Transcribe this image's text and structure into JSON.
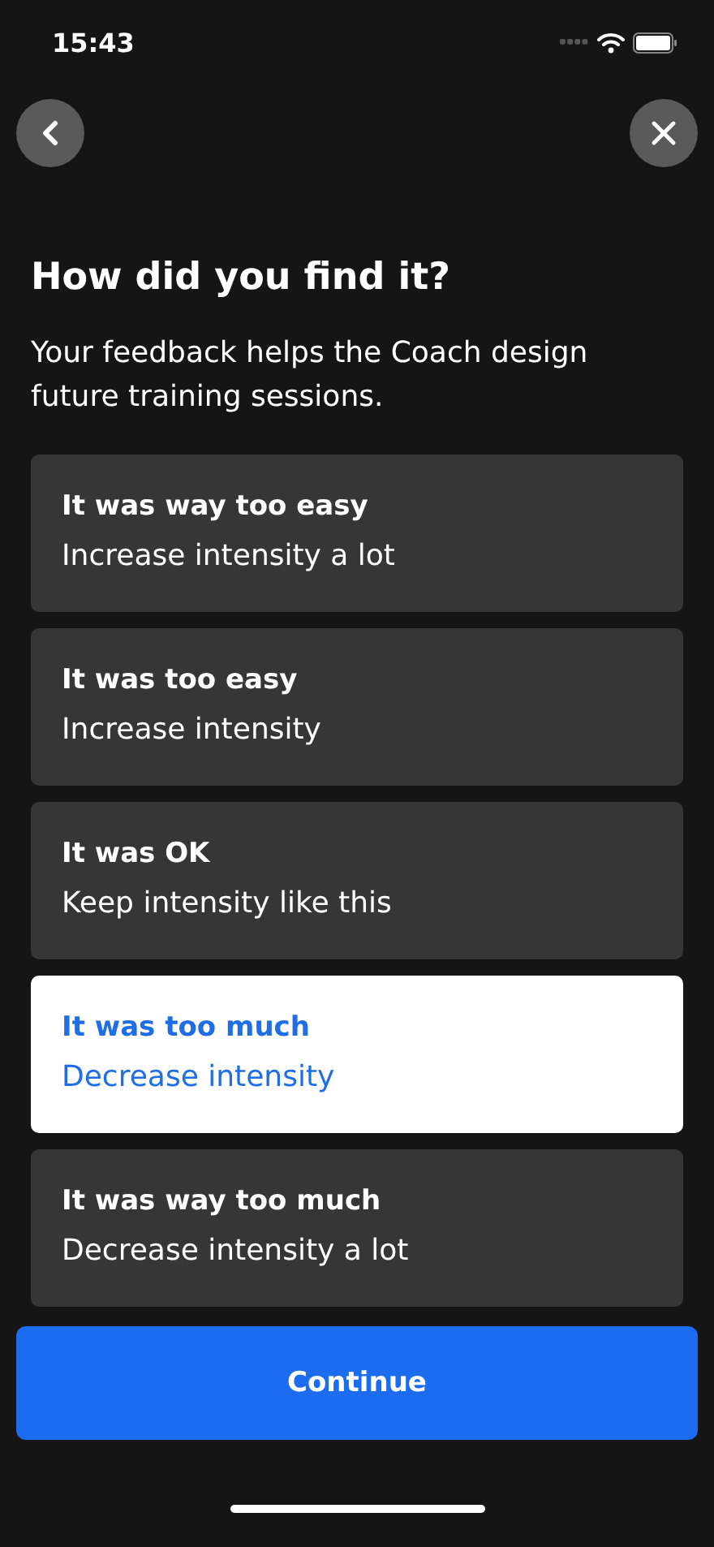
{
  "status_bar": {
    "time": "15:43"
  },
  "title": "How did you find it?",
  "subtitle": "Your feedback helps the Coach design future training sessions.",
  "options": [
    {
      "title": "It was way too easy",
      "description": "Increase intensity a lot",
      "selected": false
    },
    {
      "title": "It was too easy",
      "description": "Increase intensity",
      "selected": false
    },
    {
      "title": "It was OK",
      "description": "Keep intensity like this",
      "selected": false
    },
    {
      "title": "It was too much",
      "description": "Decrease intensity",
      "selected": true
    },
    {
      "title": "It was way too much",
      "description": "Decrease intensity a lot",
      "selected": false
    }
  ],
  "continue_button": "Continue"
}
